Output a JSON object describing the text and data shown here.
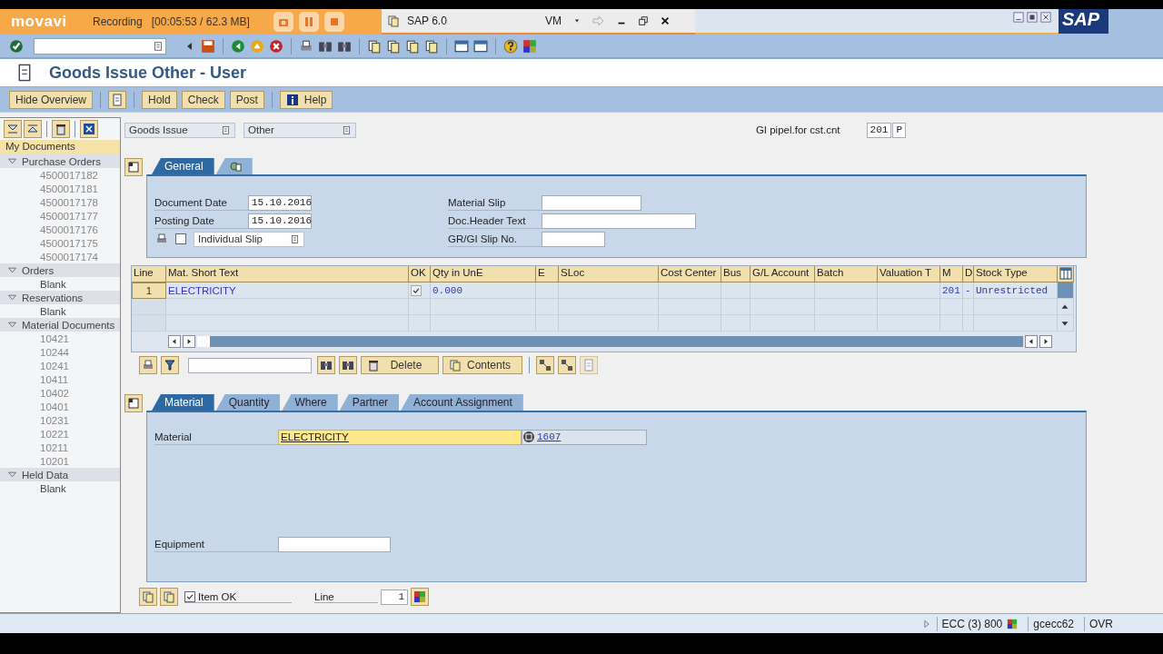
{
  "recorder": {
    "brand": "movavi",
    "status": "Recording",
    "info": "[00:05:53 / 62.3 MB]"
  },
  "browser": {
    "tab_title": "SAP 6.0",
    "menu": "VM"
  },
  "logo": "SAP",
  "title": "Goods Issue Other - User",
  "app_toolbar": [
    {
      "kind": "text",
      "label": "Hide Overview"
    },
    {
      "kind": "icon"
    },
    {
      "kind": "text",
      "label": "Hold"
    },
    {
      "kind": "text",
      "label": "Check"
    },
    {
      "kind": "text",
      "label": "Post"
    },
    {
      "kind": "help",
      "label": "Help"
    }
  ],
  "sidebar": {
    "header": "My Documents",
    "groups": [
      {
        "label": "Purchase Orders",
        "expanded": true,
        "children": [
          {
            "label": "4500017182"
          },
          {
            "label": "4500017181"
          },
          {
            "label": "4500017178"
          },
          {
            "label": "4500017177"
          },
          {
            "label": "4500017176"
          },
          {
            "label": "4500017175"
          },
          {
            "label": "4500017174"
          }
        ]
      },
      {
        "label": "Orders",
        "expanded": true,
        "children": [
          {
            "label": "Blank"
          }
        ]
      },
      {
        "label": "Reservations",
        "expanded": true,
        "children": [
          {
            "label": "Blank"
          }
        ]
      },
      {
        "label": "Material Documents",
        "expanded": true,
        "children": [
          {
            "label": "10421"
          },
          {
            "label": "10244"
          },
          {
            "label": "10241"
          },
          {
            "label": "10411"
          },
          {
            "label": "10402"
          },
          {
            "label": "10401"
          },
          {
            "label": "10231"
          },
          {
            "label": "10221"
          },
          {
            "label": "10211"
          },
          {
            "label": "10201"
          }
        ]
      },
      {
        "label": "Held Data",
        "expanded": true,
        "children": [
          {
            "label": "Blank"
          }
        ]
      }
    ]
  },
  "header": {
    "transaction": "Goods Issue",
    "reference": "Other",
    "movement_label": "GI pipel.for cst.cnt",
    "movement_type": "201",
    "special_stock": "P"
  },
  "header_tabs": [
    {
      "kind": "text",
      "label": "General",
      "selected": true
    },
    {
      "kind": "icon",
      "selected": false
    }
  ],
  "general": {
    "left": [
      {
        "label": "Document Date",
        "value": "15.10.2016"
      },
      {
        "label": "Posting Date",
        "value": "15.10.2016"
      }
    ],
    "print_checked": false,
    "slip": "Individual Slip",
    "right": [
      {
        "label": "Material Slip"
      },
      {
        "label": "Doc.Header Text"
      },
      {
        "label": "GR/GI Slip No."
      }
    ]
  },
  "table": {
    "columns": [
      "Line",
      "Mat. Short Text",
      "OK",
      "Qty in UnE",
      "E",
      "SLoc",
      "Cost Center",
      "Bus",
      "G/L Account",
      "Batch",
      "Valuation T",
      "M",
      "D",
      "Stock Type"
    ],
    "rows": [
      {
        "line": "1",
        "text": "ELECTRICITY",
        "ok": true,
        "qty": "0.000",
        "m": "201",
        "d": "-",
        "stock_type": "Unrestricted"
      }
    ]
  },
  "table_toolbar": {
    "buttons": [
      "Delete",
      "Contents"
    ]
  },
  "item_tabs": [
    {
      "label": "Material",
      "selected": true
    },
    {
      "label": "Quantity",
      "selected": false
    },
    {
      "label": "Where",
      "selected": false
    },
    {
      "label": "Partner",
      "selected": false
    },
    {
      "label": "Account Assignment",
      "selected": false
    }
  ],
  "item": {
    "material_label": "Material",
    "material": "ELECTRICITY",
    "material_number": "1607",
    "equipment_label": "Equipment"
  },
  "footer": {
    "item_ok": true,
    "item_ok_label": "Item OK",
    "line_label": "Line",
    "line": "1"
  },
  "status_bar": {
    "system": "ECC (3) 800",
    "server": "gcecc62",
    "mode": "OVR"
  }
}
